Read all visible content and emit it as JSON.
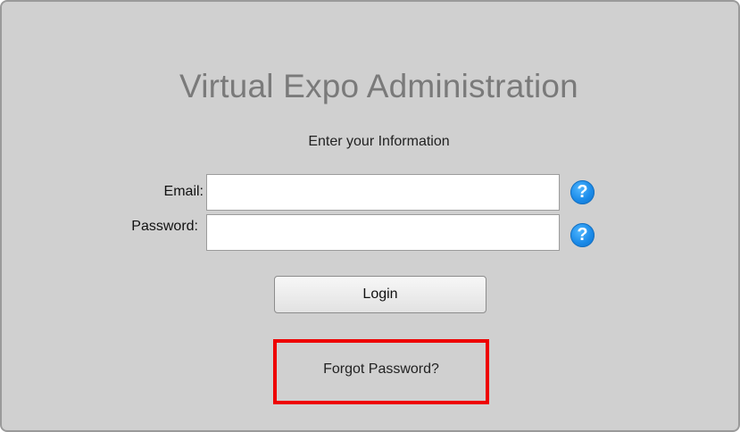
{
  "header": {
    "title": "Virtual Expo Administration",
    "subtitle": "Enter your Information"
  },
  "form": {
    "email_label": "Email:",
    "email_value": "",
    "password_label": "Password:",
    "password_value": "",
    "help_glyph": "?",
    "login_label": "Login",
    "forgot_label": "Forgot Password?"
  },
  "icons": {
    "email_help": "question-circle-icon",
    "password_help": "question-circle-icon"
  },
  "colors": {
    "panel_background": "#d0d0d0",
    "title_text": "#7a7a7a",
    "help_icon": "#1a8ae8",
    "highlight_border": "#ee0000"
  }
}
